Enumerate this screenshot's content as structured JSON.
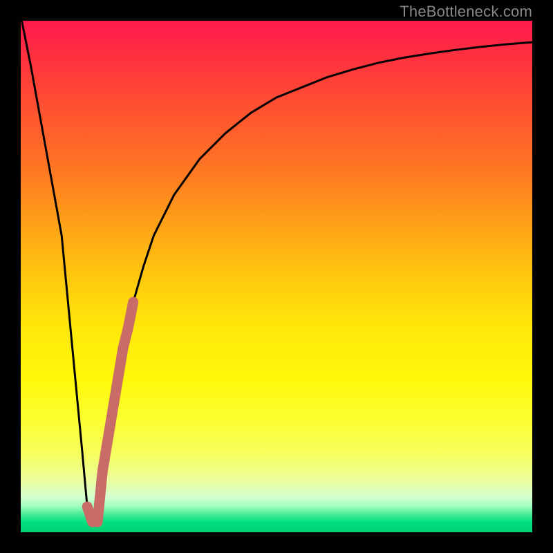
{
  "watermark": "TheBottleneck.com",
  "chart_data": {
    "type": "line",
    "title": "",
    "xlabel": "",
    "ylabel": "",
    "xlim": [
      0,
      100
    ],
    "ylim": [
      0,
      100
    ],
    "grid": false,
    "series": [
      {
        "name": "bottleneck-curve",
        "color": "#000000",
        "x": [
          0,
          2,
          4,
          6,
          8,
          10,
          12,
          13,
          14,
          16,
          18,
          20,
          22,
          24,
          26,
          30,
          35,
          40,
          45,
          50,
          55,
          60,
          65,
          70,
          75,
          80,
          85,
          90,
          95,
          100
        ],
        "y": [
          101,
          91,
          80,
          69,
          58,
          37,
          16,
          5,
          2,
          12,
          24,
          36,
          45,
          52,
          58,
          66,
          73,
          78,
          82,
          85,
          87,
          89,
          90.5,
          91.8,
          92.8,
          93.6,
          94.3,
          94.9,
          95.4,
          95.8
        ]
      },
      {
        "name": "highlight-segment",
        "color": "#c96b66",
        "x": [
          15,
          16,
          17,
          18,
          19,
          20,
          21,
          22
        ],
        "y": [
          2,
          12,
          18,
          24,
          30,
          36,
          40,
          45
        ]
      },
      {
        "name": "highlight-anchor",
        "color": "#c96b66",
        "x": [
          13,
          14
        ],
        "y": [
          5,
          2
        ]
      }
    ],
    "gradient_stops": [
      {
        "pos": 0,
        "color": "#ff1a4d"
      },
      {
        "pos": 10,
        "color": "#ff3a3a"
      },
      {
        "pos": 20,
        "color": "#ff5a2e"
      },
      {
        "pos": 30,
        "color": "#ff7a22"
      },
      {
        "pos": 40,
        "color": "#ffa218"
      },
      {
        "pos": 50,
        "color": "#ffc80e"
      },
      {
        "pos": 60,
        "color": "#ffe80a"
      },
      {
        "pos": 70,
        "color": "#fff80a"
      },
      {
        "pos": 78,
        "color": "#fcff30"
      },
      {
        "pos": 85,
        "color": "#f6ff60"
      },
      {
        "pos": 90,
        "color": "#ecffa0"
      },
      {
        "pos": 93,
        "color": "#d8ffd0"
      },
      {
        "pos": 95,
        "color": "#a0ffc0"
      },
      {
        "pos": 96,
        "color": "#60f0a0"
      },
      {
        "pos": 97,
        "color": "#30e890"
      },
      {
        "pos": 98,
        "color": "#00e080"
      },
      {
        "pos": 99,
        "color": "#00d878"
      },
      {
        "pos": 100,
        "color": "#00d070"
      }
    ]
  }
}
